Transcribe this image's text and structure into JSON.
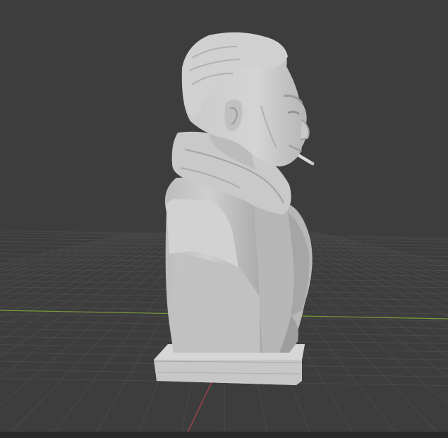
{
  "viewport": {
    "background_color": "#3d3d3d",
    "grid_line_color": "#4a4a4a",
    "x_axis_color": "#7a9a3a",
    "y_axis_color": "#b0444e",
    "model_color": "#c4c4c4",
    "model_shadow_color": "#8a8a8a",
    "model_highlight_color": "#dedede",
    "bottom_strip_color": "#2a2a2a"
  }
}
